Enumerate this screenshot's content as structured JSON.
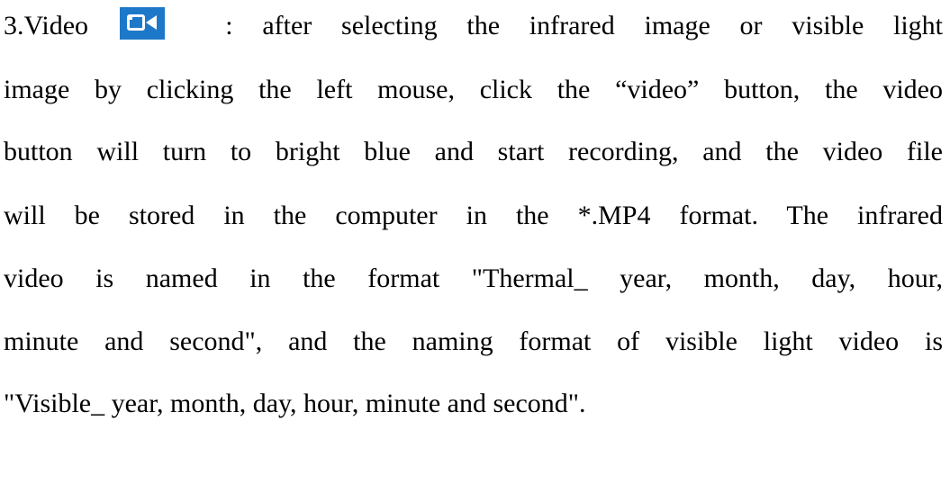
{
  "paragraph": {
    "line1_prefix": "3.Video",
    "video_icon": "video-camera-icon",
    "icon_color": "#1e78c9",
    "line1_suffix": ": after selecting the infrared image or visible light",
    "line2": "image by clicking the left mouse, click the “video” button, the video",
    "line3": "button will turn to bright blue and start recording, and the video file",
    "line4": "will be stored in the computer in the *.MP4 format. The infrared",
    "line5": "video is named in the format \"Thermal_ year, month, day, hour,",
    "line6": "minute and second\", and the naming format of visible light video is",
    "line7": "\"Visible_ year, month, day, hour, minute and second\"."
  }
}
